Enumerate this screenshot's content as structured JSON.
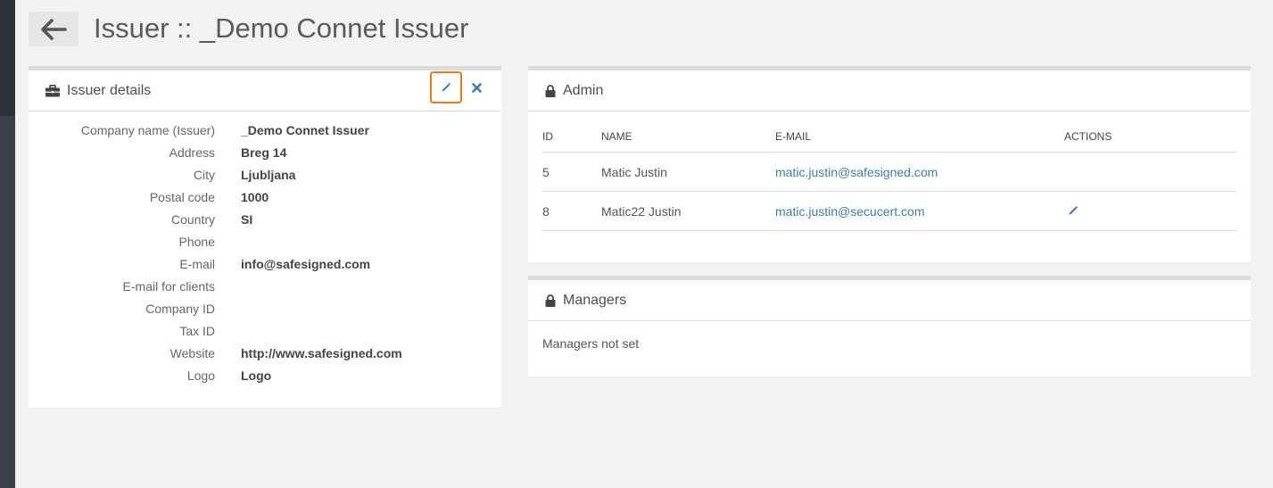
{
  "page": {
    "title": "Issuer :: _Demo Connet Issuer"
  },
  "details": {
    "title": "Issuer details",
    "fields": [
      {
        "label": "Company name (Issuer)",
        "value": "_Demo Connet Issuer"
      },
      {
        "label": "Address",
        "value": "Breg 14"
      },
      {
        "label": "City",
        "value": "Ljubljana"
      },
      {
        "label": "Postal code",
        "value": "1000"
      },
      {
        "label": "Country",
        "value": "SI"
      },
      {
        "label": "Phone",
        "value": ""
      },
      {
        "label": "E-mail",
        "value": "info@safesigned.com"
      },
      {
        "label": "E-mail for clients",
        "value": ""
      },
      {
        "label": "Company ID",
        "value": ""
      },
      {
        "label": "Tax ID",
        "value": ""
      },
      {
        "label": "Website",
        "value": "http://www.safesigned.com"
      },
      {
        "label": "Logo",
        "value": "Logo"
      }
    ]
  },
  "admin": {
    "title": "Admin",
    "columns": {
      "id": "ID",
      "name": "NAME",
      "email": "E-MAIL",
      "actions": "ACTIONS"
    },
    "rows": [
      {
        "id": "5",
        "name": "Matic Justin",
        "email": "matic.justin@safesigned.com",
        "editable": false
      },
      {
        "id": "8",
        "name": "Matic22 Justin",
        "email": "matic.justin@secucert.com",
        "editable": true
      }
    ]
  },
  "managers": {
    "title": "Managers",
    "empty_text": "Managers not set"
  },
  "icons": {
    "back": "arrow-left-icon",
    "details": "briefcase-icon",
    "edit": "pencil-icon",
    "close": "close-icon",
    "admin": "lock-icon",
    "managers": "lock-icon"
  },
  "colors": {
    "accent_edit": "#ea7c1a",
    "link": "#3d7ea6",
    "close_icon": "#3d7ea6"
  }
}
